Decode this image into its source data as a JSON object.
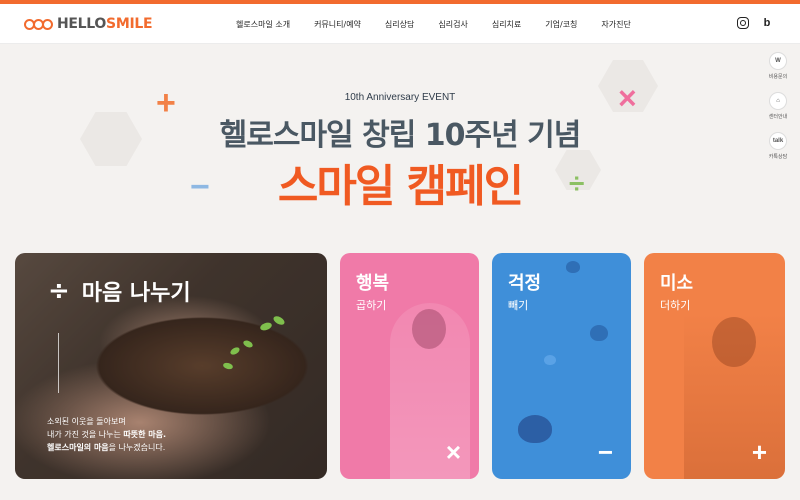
{
  "brand": {
    "logo_hello": "HELLO",
    "logo_smile": "SMILE",
    "accent": "#f26b2e"
  },
  "nav": {
    "items": [
      "헬로스마일 소개",
      "커뮤니티/예약",
      "심리상담",
      "심리검사",
      "심리치료",
      "기업/코칭",
      "자가진단"
    ]
  },
  "social": {
    "instagram_icon": "instagram-icon",
    "blog_label": "b"
  },
  "quick_menu": {
    "items": [
      {
        "icon_text": "W",
        "label": "비용문의"
      },
      {
        "icon_text": "⌂",
        "label": "센터안내"
      },
      {
        "icon_text": "talk",
        "label": "카톡상담"
      }
    ]
  },
  "hero": {
    "event_label": "10th Anniversary EVENT",
    "title": "헬로스마일 창립 10주년 기념",
    "subtitle": "스마일 캠페인"
  },
  "cards": {
    "main": {
      "operator": "÷",
      "title": "마음 나누기",
      "desc_line1": "소외된 이웃을 돌아보며",
      "desc_line2_a": "내가 가진 것을 나누는 ",
      "desc_line2_b": "따뜻한 마음.",
      "desc_line3_a": "헬로스마일의 마음",
      "desc_line3_b": "을 나누겠습니다."
    },
    "pink": {
      "title": "행복",
      "sub": "곱하기",
      "operator": "×",
      "color": "#f07aa8"
    },
    "blue": {
      "title": "걱정",
      "sub": "빼기",
      "operator": "−",
      "color": "#3f8fd9"
    },
    "orange": {
      "title": "미소",
      "sub": "더하기",
      "operator": "+",
      "color": "#f28147"
    }
  }
}
